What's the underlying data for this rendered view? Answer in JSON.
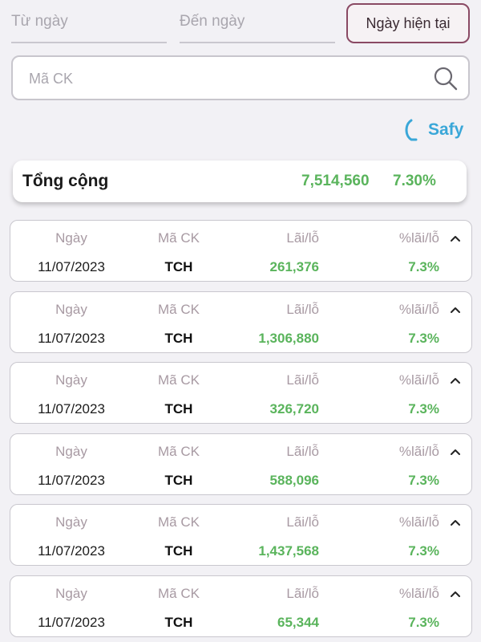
{
  "filters": {
    "from_placeholder": "Từ ngày",
    "to_placeholder": "Đến ngày",
    "today_button": "Ngày hiện tại"
  },
  "search": {
    "placeholder": "Mã CK",
    "icon": "search-icon"
  },
  "brand": {
    "name": "Safy",
    "color": "#3aa7d8"
  },
  "total": {
    "label": "Tổng cộng",
    "amount": "7,514,560",
    "percent": "7.30%"
  },
  "columns": {
    "date": "Ngày",
    "symbol": "Mã CK",
    "profit_loss": "Lãi/lỗ",
    "percent": "%lãi/lỗ"
  },
  "colors": {
    "gain": "#5ab45c",
    "accent": "#8a4a64"
  },
  "rows": [
    {
      "date": "11/07/2023",
      "symbol": "TCH",
      "profit_loss": "261,376",
      "percent": "7.3%"
    },
    {
      "date": "11/07/2023",
      "symbol": "TCH",
      "profit_loss": "1,306,880",
      "percent": "7.3%"
    },
    {
      "date": "11/07/2023",
      "symbol": "TCH",
      "profit_loss": "326,720",
      "percent": "7.3%"
    },
    {
      "date": "11/07/2023",
      "symbol": "TCH",
      "profit_loss": "588,096",
      "percent": "7.3%"
    },
    {
      "date": "11/07/2023",
      "symbol": "TCH",
      "profit_loss": "1,437,568",
      "percent": "7.3%"
    },
    {
      "date": "11/07/2023",
      "symbol": "TCH",
      "profit_loss": "65,344",
      "percent": "7.3%"
    }
  ]
}
